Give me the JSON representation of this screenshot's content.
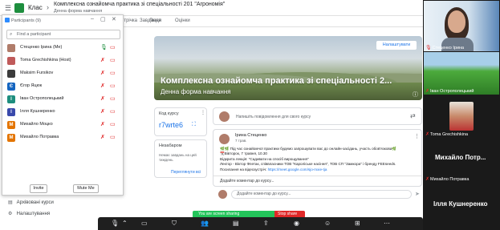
{
  "classroom": {
    "app_name": "Клас",
    "course_title": "Комплексна ознайомча практика зі спеціальності 201 \"Агрономія\"",
    "course_subtitle": "Денна форма навчання",
    "tabs": [
      "Стрічка",
      "Завдання",
      "Люди",
      "Оцінки"
    ]
  },
  "sidebar": {
    "items": [
      {
        "label": "Архівовані курси",
        "icon": "archive-icon"
      },
      {
        "label": "Налаштування",
        "icon": "gear-icon"
      }
    ]
  },
  "participants": {
    "title": "Participants (9)",
    "search_placeholder": "Find a participant",
    "list": [
      {
        "name": "Стеценко Ірина (Me)",
        "initial": "",
        "color": "#b07c6a",
        "mic": "on",
        "cam": "off"
      },
      {
        "name": "Toma Grechishkina (Host)",
        "initial": "",
        "color": "#c05a5a",
        "mic": "off",
        "cam": "off"
      },
      {
        "name": "Maksim Fursikov",
        "initial": "",
        "color": "#3b3b3b",
        "mic": "off",
        "cam": "off"
      },
      {
        "name": "Єгор Яцюк",
        "initial": "Є",
        "color": "#1565c0",
        "mic": "off",
        "cam": "off"
      },
      {
        "name": "Іван Острополецький",
        "initial": "І",
        "color": "#1e8e7e",
        "mic": "off",
        "cam": "off"
      },
      {
        "name": "Ілля Кушнеренко",
        "initial": "І",
        "color": "#3949ab",
        "mic": "off",
        "cam": "off"
      },
      {
        "name": "Михайло Моцко",
        "initial": "М",
        "color": "#e37400",
        "mic": "off",
        "cam": "off"
      },
      {
        "name": "Михайло Потравка",
        "initial": "М",
        "color": "#e37400",
        "mic": "off",
        "cam": "off"
      }
    ],
    "invite_label": "Invite",
    "mute_me_label": "Mute Me"
  },
  "banner": {
    "title": "Комплексна ознайомча практика зі спеціальності 2...",
    "subtitle": "Денна форма навчання",
    "customize_label": "Налаштувати"
  },
  "class_code": {
    "label": "Код курсу",
    "value": "r7wrte6"
  },
  "upcoming": {
    "label": "Незабаром",
    "text": "Немає завдань на цей тиждень",
    "link": "Переглянути всі"
  },
  "announce": {
    "placeholder": "Напишіть повідомлення для свого курсу"
  },
  "post": {
    "author": "Ірина Стеценко",
    "date": "7 трав.",
    "lines": [
      "🌿🌿 Під час ознайомчої практики будемо запрошувати вас до онлайн-засідань, участь обов'язкова🌿",
      "",
      "📆Вівторок, 7 травня, 10.30",
      "Відкрита лекція: \"Садивати на спосіб вирощування\"",
      "Лектор - Віктор Флетак, співвласники ТОВ \"Кароліське насіння\", ТОВ СП \"Замкора\" і бренду FEEseeds.",
      "Посилання на відеозустріч: "
    ],
    "link_text": "https://meet.google.com/sjo-mxie-tja",
    "comments_label": "Додайте коментар до курсу..."
  },
  "comment": {
    "placeholder": "Додайте коментар до курсу..."
  },
  "share": {
    "sharing_text": "You are screen sharing",
    "stop_label": "Stop share"
  },
  "gallery": [
    {
      "label": "Стеценко Ірина"
    },
    {
      "label": "Іван Острополецький"
    },
    {
      "label": "Toma Grechishkina"
    },
    {
      "big": "Михайло Потр...",
      "label": "Михайло Потравка"
    },
    {
      "big": "Ілля Кушнеренко"
    }
  ],
  "colors": {
    "accent": "#1a73e8",
    "classroom_green": "#1e8e3e",
    "share_green": "#23c45a",
    "stop_red": "#e02828",
    "zoom_bar": "#1f1f1f"
  }
}
